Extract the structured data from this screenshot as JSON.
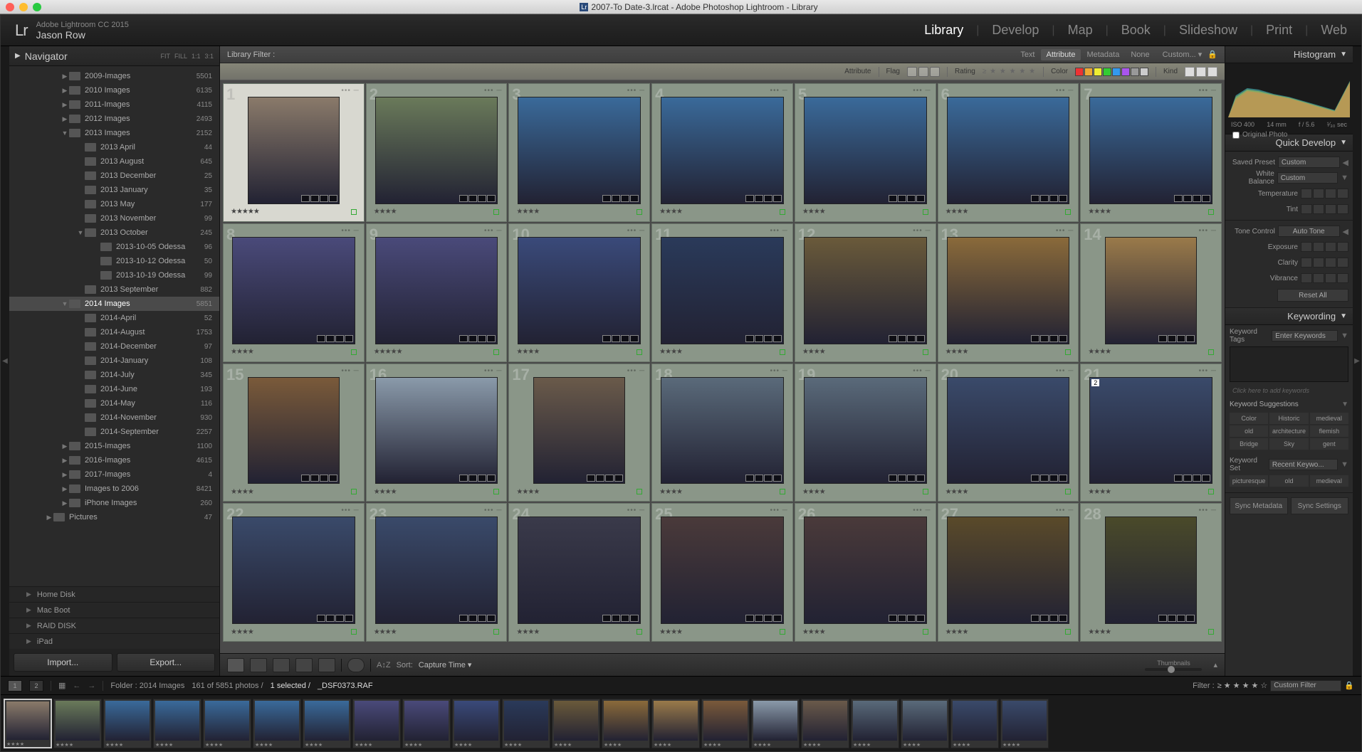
{
  "window_title": "2007-To Date-3.lrcat - Adobe Photoshop Lightroom - Library",
  "app_version": "Adobe Lightroom CC 2015",
  "user_name": "Jason Row",
  "modules": [
    "Library",
    "Develop",
    "Map",
    "Book",
    "Slideshow",
    "Print",
    "Web"
  ],
  "active_module": "Library",
  "navigator": {
    "title": "Navigator",
    "opts": [
      "FIT",
      "FILL",
      "1:1",
      "3:1"
    ]
  },
  "folders": [
    {
      "depth": 1,
      "name": "2009-Images",
      "count": 5501,
      "expand": "▶"
    },
    {
      "depth": 1,
      "name": "2010 Images",
      "count": 6135,
      "expand": "▶"
    },
    {
      "depth": 1,
      "name": "2011-Images",
      "count": 4115,
      "expand": "▶"
    },
    {
      "depth": 1,
      "name": "2012 Images",
      "count": 2493,
      "expand": "▶"
    },
    {
      "depth": 1,
      "name": "2013 Images",
      "count": 2152,
      "expand": "▼"
    },
    {
      "depth": 2,
      "name": "2013 April",
      "count": 44,
      "expand": ""
    },
    {
      "depth": 2,
      "name": "2013 August",
      "count": 645,
      "expand": ""
    },
    {
      "depth": 2,
      "name": "2013 December",
      "count": 25,
      "expand": ""
    },
    {
      "depth": 2,
      "name": "2013 January",
      "count": 35,
      "expand": ""
    },
    {
      "depth": 2,
      "name": "2013 May",
      "count": 177,
      "expand": ""
    },
    {
      "depth": 2,
      "name": "2013 November",
      "count": 99,
      "expand": ""
    },
    {
      "depth": 2,
      "name": "2013 October",
      "count": 245,
      "expand": "▼"
    },
    {
      "depth": 3,
      "name": "2013-10-05 Odessa",
      "count": 96,
      "expand": ""
    },
    {
      "depth": 3,
      "name": "2013-10-12 Odessa",
      "count": 50,
      "expand": ""
    },
    {
      "depth": 3,
      "name": "2013-10-19 Odessa",
      "count": 99,
      "expand": ""
    },
    {
      "depth": 2,
      "name": "2013 September",
      "count": 882,
      "expand": ""
    },
    {
      "depth": 1,
      "name": "2014 Images",
      "count": 5851,
      "expand": "▼",
      "selected": true
    },
    {
      "depth": 2,
      "name": "2014-April",
      "count": 52,
      "expand": ""
    },
    {
      "depth": 2,
      "name": "2014-August",
      "count": 1753,
      "expand": ""
    },
    {
      "depth": 2,
      "name": "2014-December",
      "count": 97,
      "expand": ""
    },
    {
      "depth": 2,
      "name": "2014-January",
      "count": 108,
      "expand": ""
    },
    {
      "depth": 2,
      "name": "2014-July",
      "count": 345,
      "expand": ""
    },
    {
      "depth": 2,
      "name": "2014-June",
      "count": 193,
      "expand": ""
    },
    {
      "depth": 2,
      "name": "2014-May",
      "count": 116,
      "expand": ""
    },
    {
      "depth": 2,
      "name": "2014-November",
      "count": 930,
      "expand": ""
    },
    {
      "depth": 2,
      "name": "2014-September",
      "count": 2257,
      "expand": ""
    },
    {
      "depth": 1,
      "name": "2015-Images",
      "count": 1100,
      "expand": "▶"
    },
    {
      "depth": 1,
      "name": "2016-Images",
      "count": 4615,
      "expand": "▶"
    },
    {
      "depth": 1,
      "name": "2017-Images",
      "count": 4,
      "expand": "▶"
    },
    {
      "depth": 1,
      "name": "Images to 2006",
      "count": 8421,
      "expand": "▶"
    },
    {
      "depth": 1,
      "name": "iPhone Images",
      "count": 260,
      "expand": "▶"
    },
    {
      "depth": 0,
      "name": "Pictures",
      "count": 47,
      "expand": "▶"
    }
  ],
  "volumes": [
    "Home Disk",
    "Mac Boot",
    "RAID DISK",
    "iPad"
  ],
  "import_label": "Import...",
  "export_label": "Export...",
  "filter": {
    "label": "Library Filter :",
    "tabs": [
      "Text",
      "Attribute",
      "Metadata",
      "None"
    ],
    "active": "Attribute",
    "preset": "Custom..."
  },
  "attr_bar": {
    "attribute": "Attribute",
    "flag": "Flag",
    "rating": "Rating",
    "color": "Color",
    "kind": "Kind",
    "color_swatches": [
      "#e33",
      "#ea3",
      "#ee3",
      "#3c3",
      "#39e",
      "#a5e",
      "#999",
      "#ccc"
    ]
  },
  "grid_cells": [
    {
      "n": 1,
      "stars": 5,
      "sel": true,
      "thumb": "#8a7a6a",
      "portrait": true
    },
    {
      "n": 2,
      "stars": 4,
      "thumb": "#6a7a5a"
    },
    {
      "n": 3,
      "stars": 4,
      "thumb": "#3a6a9a"
    },
    {
      "n": 4,
      "stars": 4,
      "thumb": "#3a6a9a"
    },
    {
      "n": 5,
      "stars": 4,
      "thumb": "#3a6a9a"
    },
    {
      "n": 6,
      "stars": 4,
      "thumb": "#3a6a9a"
    },
    {
      "n": 7,
      "stars": 4,
      "thumb": "#3a6a9a"
    },
    {
      "n": 8,
      "stars": 4,
      "thumb": "#4a4a7a"
    },
    {
      "n": 9,
      "stars": 5,
      "thumb": "#4a4a7a"
    },
    {
      "n": 10,
      "stars": 4,
      "thumb": "#3a4a7a"
    },
    {
      "n": 11,
      "stars": 4,
      "thumb": "#2a3a5a"
    },
    {
      "n": 12,
      "stars": 4,
      "thumb": "#6a5a3a"
    },
    {
      "n": 13,
      "stars": 4,
      "thumb": "#8a6a3a"
    },
    {
      "n": 14,
      "stars": 4,
      "thumb": "#9a7a4a",
      "portrait": true
    },
    {
      "n": 15,
      "stars": 4,
      "thumb": "#7a5a3a",
      "portrait": true
    },
    {
      "n": 16,
      "stars": 4,
      "thumb": "#8a9aaa"
    },
    {
      "n": 17,
      "stars": 4,
      "thumb": "#6a5a4a",
      "portrait": true
    },
    {
      "n": 18,
      "stars": 4,
      "thumb": "#5a6a7a"
    },
    {
      "n": 19,
      "stars": 4,
      "thumb": "#5a6a7a"
    },
    {
      "n": 20,
      "stars": 4,
      "thumb": "#3a4a6a"
    },
    {
      "n": 21,
      "stars": 4,
      "thumb": "#3a4a6a",
      "badge": "2"
    },
    {
      "n": 22,
      "stars": 4,
      "thumb": "#3a4a6a"
    },
    {
      "n": 23,
      "stars": 4,
      "thumb": "#3a4a6a"
    },
    {
      "n": 24,
      "stars": 4,
      "thumb": "#3a3a4a"
    },
    {
      "n": 25,
      "stars": 4,
      "thumb": "#4a3a3a"
    },
    {
      "n": 26,
      "stars": 4,
      "thumb": "#4a3a3a"
    },
    {
      "n": 27,
      "stars": 4,
      "thumb": "#5a4a2a"
    },
    {
      "n": 28,
      "stars": 4,
      "thumb": "#4a4a2a",
      "portrait": true
    }
  ],
  "toolbar": {
    "sort_label": "Sort:",
    "sort_value": "Capture Time",
    "thumbnails": "Thumbnails"
  },
  "histogram": {
    "title": "Histogram",
    "iso": "ISO 400",
    "focal": "14 mm",
    "aperture": "f / 5.6",
    "shutter": "¹⁄₃₀ sec",
    "original": "Original Photo"
  },
  "quick_develop": {
    "title": "Quick Develop",
    "saved_preset": "Saved Preset",
    "preset_value": "Custom",
    "white_balance": "White Balance",
    "wb_value": "Custom",
    "temperature": "Temperature",
    "tint": "Tint",
    "tone_control": "Tone Control",
    "auto_tone": "Auto Tone",
    "exposure": "Exposure",
    "clarity": "Clarity",
    "vibrance": "Vibrance",
    "reset_all": "Reset All"
  },
  "keywording": {
    "title": "Keywording",
    "tags_label": "Keyword Tags",
    "enter": "Enter Keywords",
    "placeholder": "Click here to add keywords",
    "suggestions_label": "Keyword Suggestions",
    "suggestions": [
      "Color",
      "Historic",
      "medieval",
      "old",
      "architecture",
      "flemish",
      "Bridge",
      "Sky",
      "gent"
    ],
    "set_label": "Keyword Set",
    "set_value": "Recent Keywo...",
    "set_row": [
      "picturesque",
      "old",
      "medieval"
    ]
  },
  "sync": {
    "metadata": "Sync Metadata",
    "settings": "Sync Settings"
  },
  "status": {
    "folder": "Folder : 2014 Images",
    "count": "161 of 5851 photos /",
    "selected": "1 selected /",
    "filename": "_DSF0373.RAF",
    "filter_label": "Filter :",
    "custom_filter": "Custom Filter"
  },
  "filmstrip_count": 21
}
